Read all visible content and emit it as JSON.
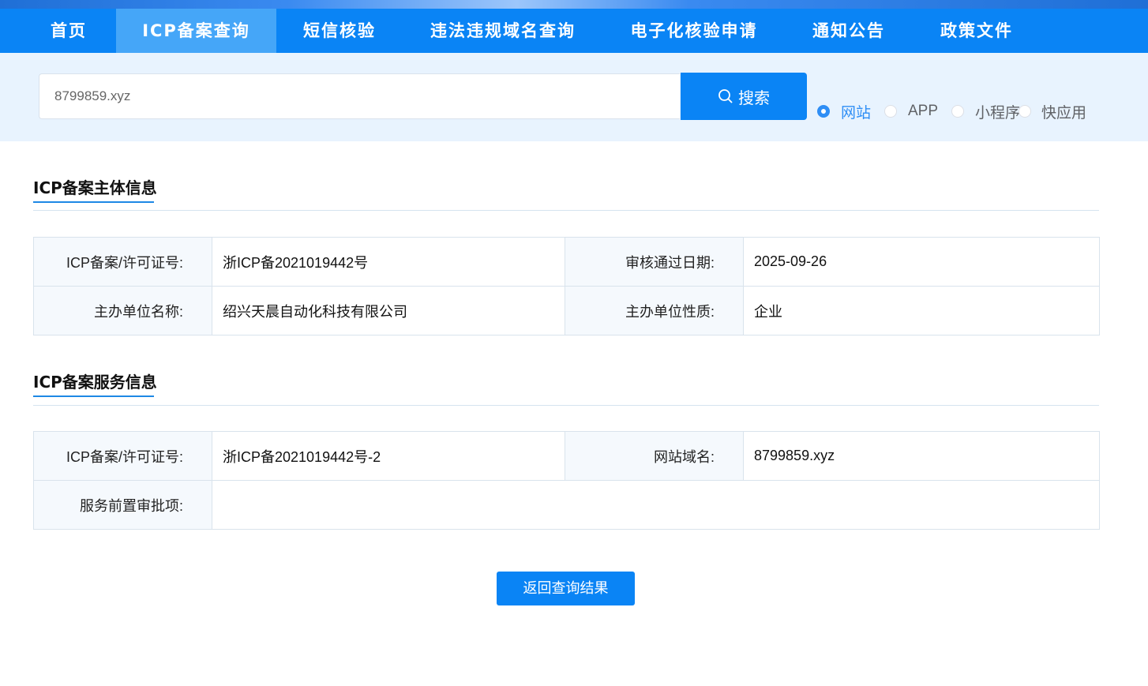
{
  "nav": {
    "items": [
      {
        "label": "首页"
      },
      {
        "label": "ICP备案查询",
        "active": true
      },
      {
        "label": "短信核验"
      },
      {
        "label": "违法违规域名查询"
      },
      {
        "label": "电子化核验申请"
      },
      {
        "label": "通知公告"
      },
      {
        "label": "政策文件"
      }
    ]
  },
  "search": {
    "value": "8799859.xyz",
    "button_label": "搜索",
    "button_icon": "search-icon",
    "types": [
      {
        "label": "网站",
        "checked": true
      },
      {
        "label": "APP",
        "checked": false
      },
      {
        "label": "小程序",
        "checked": false
      },
      {
        "label": "快应用",
        "checked": false
      }
    ]
  },
  "entity_info": {
    "title": "ICP备案主体信息",
    "license_label": "ICP备案/许可证号:",
    "license_value": "浙ICP备2021019442号",
    "approve_date_label": "审核通过日期:",
    "approve_date_value": "2025-09-26",
    "org_name_label": "主办单位名称:",
    "org_name_value": "绍兴天晨自动化科技有限公司",
    "org_type_label": "主办单位性质:",
    "org_type_value": "企业"
  },
  "service_info": {
    "title": "ICP备案服务信息",
    "license_label": "ICP备案/许可证号:",
    "license_value": "浙ICP备2021019442号-2",
    "domain_label": "网站域名:",
    "domain_value": "8799859.xyz",
    "pre_approval_label": "服务前置审批项:",
    "pre_approval_value": ""
  },
  "back_button_label": "返回查询结果",
  "colors": {
    "primary": "#0a84f5",
    "nav_active": "#45a6f8",
    "search_band": "#e8f3fe",
    "label_cell": "#f5f9fd"
  }
}
